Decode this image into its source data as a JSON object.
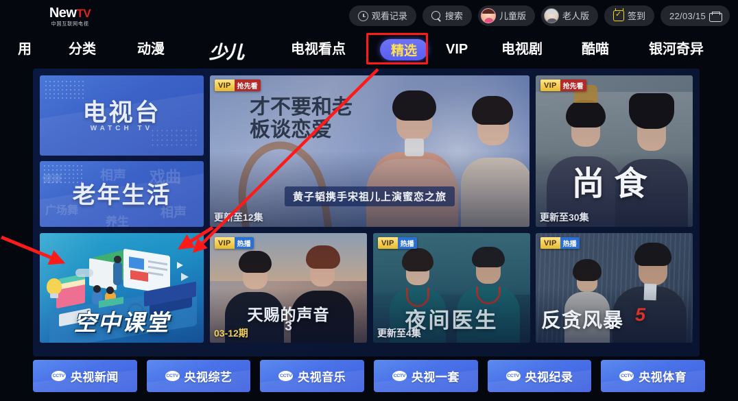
{
  "header": {
    "logo": {
      "main": "New",
      "tv": "TV",
      "sub": "中国互联网电视"
    },
    "buttons": [
      {
        "name": "watch-history",
        "label": "观看记录",
        "icon": "clock-icon"
      },
      {
        "name": "search",
        "label": "搜索",
        "icon": "search-icon"
      },
      {
        "name": "kids-mode",
        "label": "儿童版",
        "icon": "kid-avatar-icon"
      },
      {
        "name": "elderly-mode",
        "label": "老人版",
        "icon": "elderly-avatar-icon"
      },
      {
        "name": "check-in",
        "label": "签到",
        "icon": "calendar-check-icon"
      },
      {
        "name": "date",
        "label": "22/03/15",
        "icon": "network-icon"
      }
    ]
  },
  "nav": {
    "items": [
      {
        "label": "用",
        "selected": false
      },
      {
        "label": "分类",
        "selected": false
      },
      {
        "label": "动漫",
        "selected": false
      },
      {
        "label": "少儿",
        "selected": false,
        "style": "logo"
      },
      {
        "label": "电视看点",
        "selected": false
      },
      {
        "label": "精选",
        "selected": true
      },
      {
        "label": "VIP",
        "selected": false
      },
      {
        "label": "电视剧",
        "selected": false
      },
      {
        "label": "酷喵",
        "selected": false
      },
      {
        "label": "银河奇异",
        "selected": false
      }
    ],
    "selected_dots": "..........."
  },
  "content": {
    "promos": [
      {
        "name": "tv-station",
        "title": "电视台",
        "subtitle": "WATCH TV"
      },
      {
        "name": "elderly-life",
        "title": "老年生活",
        "subtitle": "",
        "ghost_words": [
          "相声",
          "戏曲",
          "广场舞",
          "养生",
          "相声",
          "健康"
        ]
      }
    ],
    "classroom": {
      "name": "air-classroom",
      "title": "空中课堂"
    },
    "posters": [
      {
        "name": "boss-romance",
        "vip": "VIP",
        "tag": "抢先看",
        "tag_color": "red",
        "title": "才不要和老板谈恋爱",
        "caption": "黄子韬携手宋祖儿上演蜜恋之旅",
        "episode": "更新至12集"
      },
      {
        "name": "shang-shi",
        "vip": "VIP",
        "tag": "抢先看",
        "tag_color": "red",
        "title": "尚食",
        "caption": "",
        "episode": "更新至30集"
      },
      {
        "name": "voice-gifted",
        "vip": "VIP",
        "tag": "热播",
        "tag_color": "blue",
        "title": "天赐的声音",
        "title_num": "3",
        "caption": "",
        "episode": "03-12期"
      },
      {
        "name": "night-doctor",
        "vip": "VIP",
        "tag": "热播",
        "tag_color": "blue",
        "title": "夜间医生",
        "caption": "",
        "episode": "更新至4集"
      },
      {
        "name": "anti-corruption-storm-5",
        "vip": "VIP",
        "tag": "热播",
        "tag_color": "blue",
        "title": "反贪风暴",
        "title_num": "5",
        "caption": "",
        "episode": ""
      }
    ]
  },
  "channels": [
    {
      "name": "cctv-news",
      "logo": "CCTV",
      "label": "央视新闻"
    },
    {
      "name": "cctv-variety",
      "logo": "CCTV",
      "label": "央视综艺"
    },
    {
      "name": "cctv-music",
      "logo": "CCTV",
      "label": "央视音乐"
    },
    {
      "name": "cctv-channel-1",
      "logo": "CCTV",
      "label": "央视一套"
    },
    {
      "name": "cctv-documentary",
      "logo": "CCTV",
      "label": "央视纪录"
    },
    {
      "name": "cctv-sports",
      "logo": "CCTV",
      "label": "央视体育"
    }
  ],
  "annotations": {
    "highlight_color": "#ff1a1a",
    "arrows": [
      {
        "name": "arrow-featured-to-classroom",
        "from": "精选",
        "to": "空中课堂"
      },
      {
        "name": "arrow-left-to-classroom",
        "from": "left-edge",
        "to": "空中课堂"
      },
      {
        "name": "arrow-topright-to-classroom",
        "from": "top-right",
        "to": "空中课堂"
      }
    ]
  },
  "colors": {
    "background": "#05070f",
    "panel": "#0b1840",
    "accent_blue": "#585ef0",
    "accent_yellow": "#ffe14d",
    "vip_gold": "#e8bb2e",
    "annotation_red": "#ff1a1a"
  }
}
